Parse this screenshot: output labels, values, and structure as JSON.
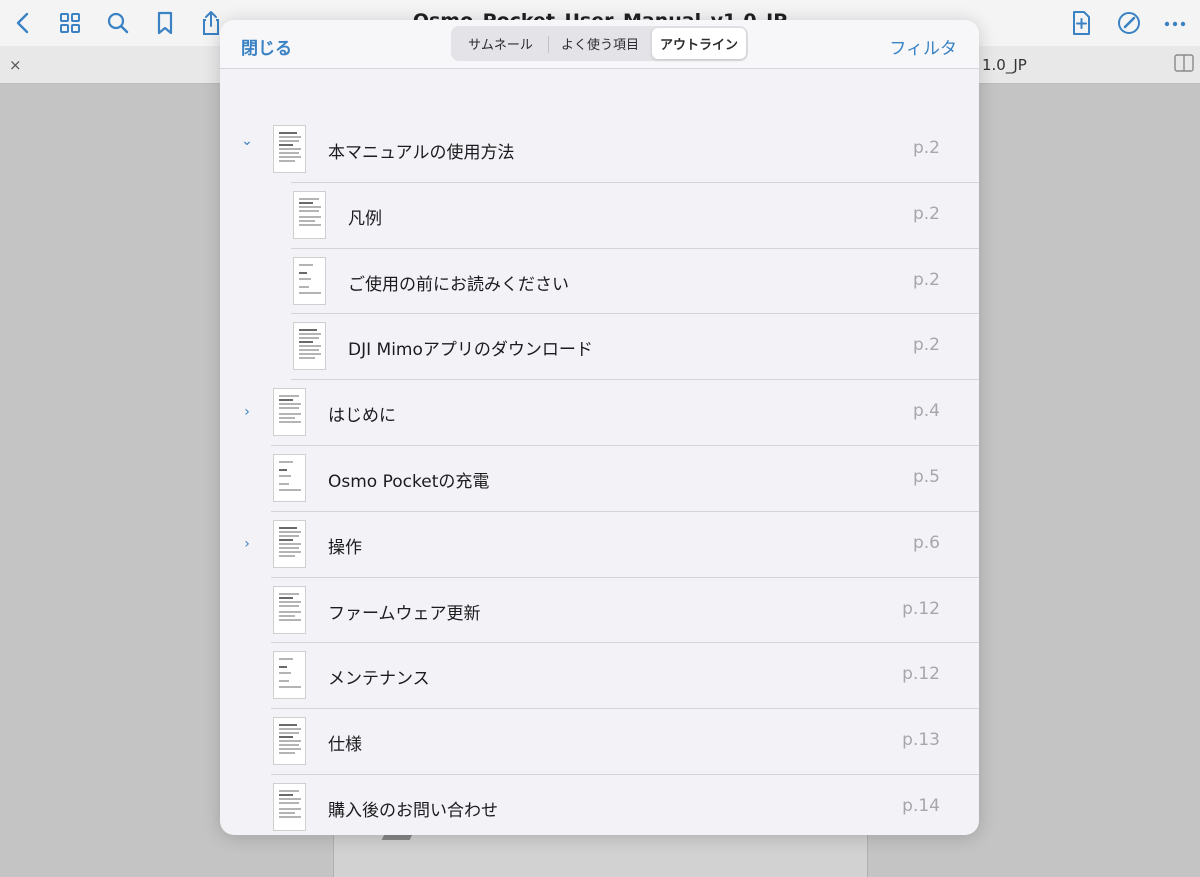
{
  "app": {
    "doc_title": "Osmo_Pocket_User_Manual_v1.0_JP",
    "tab_label": "1.0_JP",
    "tab_close": "×",
    "icons": [
      "back-icon",
      "grid-icon",
      "search-icon",
      "bookmark-icon",
      "share-icon",
      "add-page-icon",
      "annotate-icon",
      "more-icon",
      "sidebar-icon"
    ]
  },
  "modal": {
    "close_label": "閉じる",
    "filter_label": "フィルタ",
    "segments": [
      "サムネール",
      "よく使う項目",
      "アウトライン"
    ],
    "active_segment": "アウトライン",
    "accent_color": "#3a82c4"
  },
  "outline": [
    {
      "title": "本マニュアルの使用方法",
      "page": "p.2",
      "level": 0,
      "chevron": "expanded"
    },
    {
      "title": "凡例",
      "page": "p.2",
      "level": 1,
      "chevron": "none"
    },
    {
      "title": "ご使用の前にお読みください",
      "page": "p.2",
      "level": 1,
      "chevron": "none"
    },
    {
      "title": "DJI Mimoアプリのダウンロード",
      "page": "p.2",
      "level": 1,
      "chevron": "none"
    },
    {
      "title": "はじめに",
      "page": "p.4",
      "level": 0,
      "chevron": "collapsed"
    },
    {
      "title": "Osmo Pocketの充電",
      "page": "p.5",
      "level": 0,
      "chevron": "none"
    },
    {
      "title": "操作",
      "page": "p.6",
      "level": 0,
      "chevron": "collapsed"
    },
    {
      "title": "ファームウェア更新",
      "page": "p.12",
      "level": 0,
      "chevron": "none"
    },
    {
      "title": "メンテナンス",
      "page": "p.12",
      "level": 0,
      "chevron": "none"
    },
    {
      "title": "仕様",
      "page": "p.13",
      "level": 0,
      "chevron": "none"
    },
    {
      "title": "購入後のお問い合わせ",
      "page": "p.14",
      "level": 0,
      "chevron": "none"
    }
  ]
}
